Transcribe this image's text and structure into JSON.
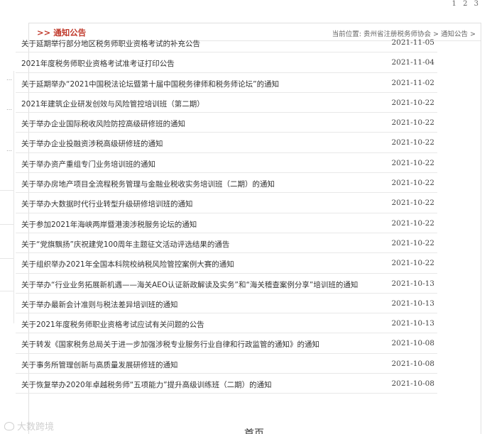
{
  "top_pager": [
    "1",
    "2",
    "3"
  ],
  "panel": {
    "title": ">> 通知公告",
    "breadcrumb": {
      "label": "当前位置: ",
      "home": "贵州省注册税务师协会",
      "sep1": " > ",
      "current": "通知公告",
      "sep2": " >"
    }
  },
  "notices": [
    {
      "title": "关于延期举行部分地区税务师职业资格考试的补充公告",
      "date": "2021-11-05"
    },
    {
      "title": "2021年度税务师职业资格考试准考证打印公告",
      "date": "2021-11-04"
    },
    {
      "title": "关于延期举办“2021中国税法论坛暨第十届中国税务律师和税务师论坛”的通知",
      "date": "2021-11-02"
    },
    {
      "title": "2021年建筑企业研发创效与风险管控培训班（第二期）",
      "date": "2021-10-22"
    },
    {
      "title": "关于举办企业国际税收风险防控高级研修班的通知",
      "date": "2021-10-22"
    },
    {
      "title": "关于举办企业投融资涉税高级研修班的通知",
      "date": "2021-10-22"
    },
    {
      "title": "关于举办资产重组专门业务培训班的通知",
      "date": "2021-10-22"
    },
    {
      "title": "关于举办房地产项目全流程税务管理与金融业税收实务培训班（二期）的通知",
      "date": "2021-10-22"
    },
    {
      "title": "关于举办大数据时代行业转型升级研修培训班的通知",
      "date": "2021-10-22"
    },
    {
      "title": "关于参加2021年海峡两岸暨港澳涉税服务论坛的通知",
      "date": "2021-10-22"
    },
    {
      "title": "关于“党旗飘扬”庆祝建党100周年主题征文活动评选结果的通告",
      "date": "2021-10-22"
    },
    {
      "title": "关于组织举办2021年全国本科院校纳税风险管控案例大赛的通知",
      "date": "2021-10-22"
    },
    {
      "title": "关于举办“行业业务拓展新机遇——海关AEO认证新政解读及实务”和“海关稽查案例分享”培训班的通知",
      "date": "2021-10-13"
    },
    {
      "title": "关于举办最新会计准则与税法差异培训班的通知",
      "date": "2021-10-13"
    },
    {
      "title": "关于2021年度税务师职业资格考试应试有关问题的公告",
      "date": "2021-10-13"
    },
    {
      "title": "关于转发《国家税务总局关于进一步加强涉税专业服务行业自律和行政监管的通知》的通知",
      "date": "2021-10-08"
    },
    {
      "title": "关于事务所管理创新与高质量发展研修班的通知",
      "date": "2021-10-08"
    },
    {
      "title": "关于恢复举办2020年卓越税务师“五项能力”提升高级训练班（二期）的通知",
      "date": "2021-10-08"
    }
  ],
  "bottom": {
    "label": "首页"
  },
  "watermark": "大数跨境",
  "colors": {
    "accent": "#c0392b",
    "border": "#e0e0e0"
  }
}
